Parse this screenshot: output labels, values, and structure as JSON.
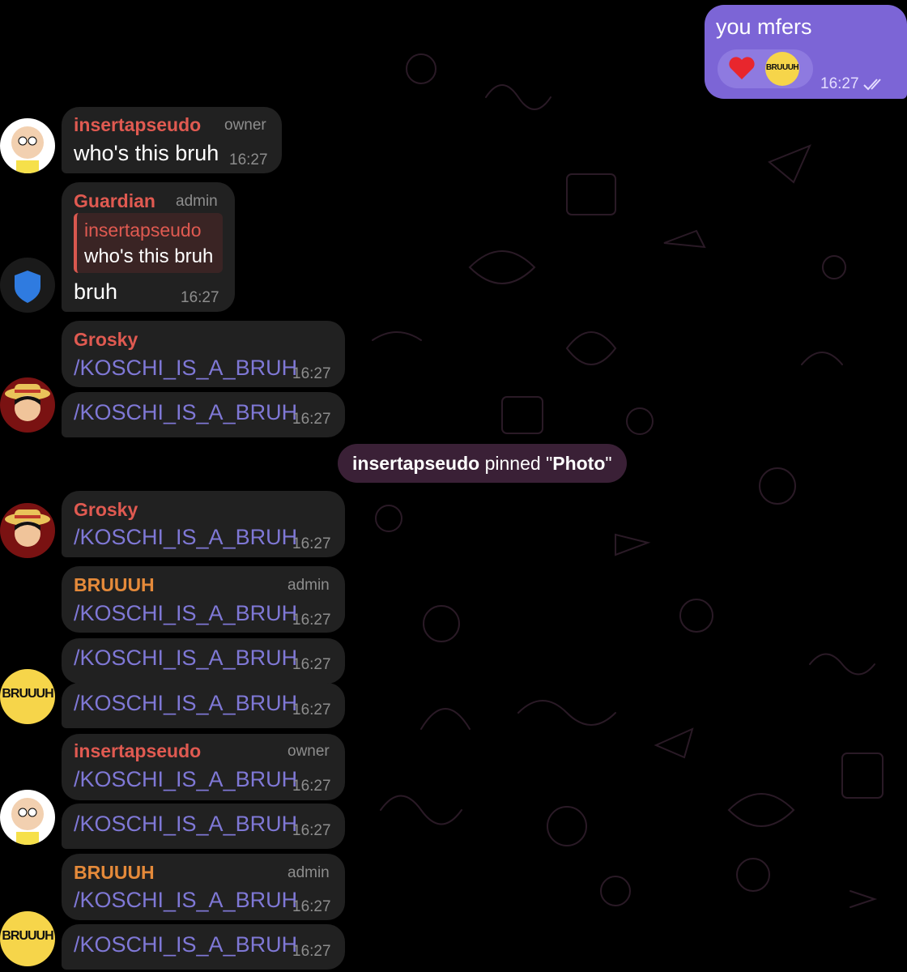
{
  "colors": {
    "background": "#000000",
    "bubble_incoming": "#212121",
    "bubble_outgoing": "#7c65d6",
    "name_red": "#e05a51",
    "name_orange": "#e58a3a",
    "command_link": "#7f78d6",
    "meta_gray": "#8d8d8d",
    "service_bg": "#3a2036"
  },
  "outgoing": {
    "text": "you mfers",
    "time": "16:27",
    "reaction_emoji": "❤️",
    "reaction_avatar_text": "BRUUUH",
    "status_icon": "double-check-icon"
  },
  "msg1": {
    "name": "insertapseudo",
    "role": "owner",
    "text": "who's this bruh",
    "time": "16:27"
  },
  "msg2": {
    "name": "Guardian",
    "role": "admin",
    "reply_name": "insertapseudo",
    "reply_text": "who's this bruh",
    "text": "bruh",
    "time": "16:27"
  },
  "msg3": {
    "name": "Grosky",
    "text": "/KOSCHI_IS_A_BRUH",
    "time": "16:27"
  },
  "msg4": {
    "text": "/KOSCHI_IS_A_BRUH",
    "time": "16:27"
  },
  "service": {
    "actor": "insertapseudo",
    "action": " pinned \"",
    "object": "Photo",
    "close": "\""
  },
  "msg5": {
    "name": "Grosky",
    "text": "/KOSCHI_IS_A_BRUH",
    "time": "16:27"
  },
  "msg6": {
    "name": "BRUUUH",
    "role": "admin",
    "text": "/KOSCHI_IS_A_BRUH",
    "time": "16:27"
  },
  "msg7": {
    "text": "/KOSCHI_IS_A_BRUH",
    "time": "16:27"
  },
  "msg8": {
    "text": "/KOSCHI_IS_A_BRUH",
    "time": "16:27"
  },
  "msg9": {
    "name": "insertapseudo",
    "role": "owner",
    "text": "/KOSCHI_IS_A_BRUH",
    "time": "16:27"
  },
  "msg10": {
    "text": "/KOSCHI_IS_A_BRUH",
    "time": "16:27"
  },
  "msg11": {
    "name": "BRUUUH",
    "role": "admin",
    "text": "/KOSCHI_IS_A_BRUH",
    "time": "16:27"
  },
  "msg12": {
    "text": "/KOSCHI_IS_A_BRUH",
    "time": "16:27"
  },
  "avatars": {
    "bruh_text": "BRUUUH"
  }
}
